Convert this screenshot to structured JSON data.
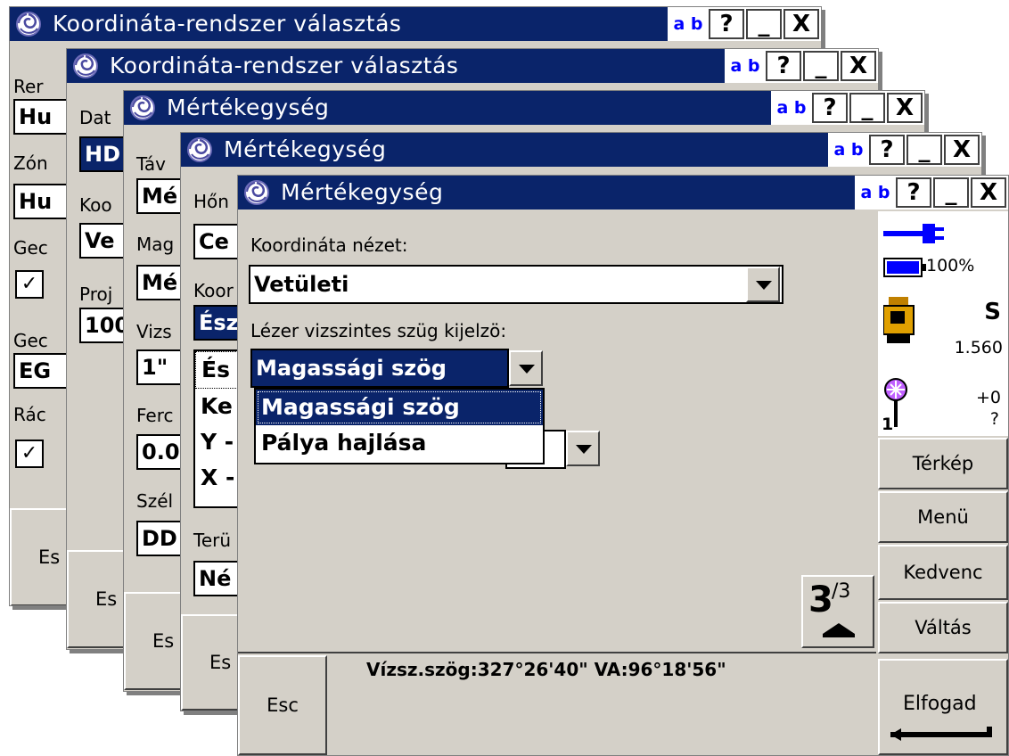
{
  "titlebar": {
    "ab_label": "a b",
    "help_label": "?",
    "minimize_label": "_",
    "close_label": "X"
  },
  "windows": {
    "w1": {
      "title": "Koordináta-rendszer választás",
      "labels": [
        "Rer",
        "Zón",
        "Gec",
        "Gec",
        "Rác"
      ],
      "fields": [
        "Hu",
        "Hu",
        "EG"
      ],
      "esc": "Es"
    },
    "w2": {
      "title": "Koordináta-rendszer választás",
      "labels": [
        "Dat",
        "Koo",
        "Proj"
      ],
      "fields": [
        "HD",
        "Ve",
        "100"
      ],
      "esc": "Es"
    },
    "w3": {
      "title": "Mértékegység",
      "labels": [
        "Táv",
        "Mag",
        "Vizs",
        "Ferc",
        "Szél"
      ],
      "fields": [
        "Mé",
        "Mé",
        "1\"",
        "0.0",
        "DD"
      ],
      "esc": "Es"
    },
    "w4": {
      "title": "Mértékegység",
      "labels": [
        "Hőn",
        "Koor",
        "Terü"
      ],
      "fields": [
        "Ce",
        "Ész",
        "Né"
      ],
      "list": [
        "És",
        "Ke",
        "Y -",
        "X -"
      ],
      "esc": "Es"
    },
    "w5": {
      "title": "Mértékegység",
      "coord_view_label": "Koordináta nézet:",
      "coord_view_value": "Vetületi",
      "laser_label": "Lézer vizszintes szüg kijelzö:",
      "laser_value": "Magassági szög",
      "dropdown_options": [
        "Magassági szög",
        "Pálya hajlása"
      ],
      "page_num": "3",
      "page_total": "/3",
      "battery_percent": "100%",
      "instrument_letter": "S",
      "instrument_height": "1.560",
      "prism_offset": "+0",
      "prism_number": "1",
      "prism_unknown": "?",
      "side_buttons": [
        "Térkép",
        "Menü",
        "Kedvenc",
        "Váltás"
      ],
      "status_text": "Vízsz.szög:327°26'40\"  VA:96°18'56\"",
      "esc_label": "Esc",
      "accept_label": "Elfogad"
    }
  },
  "colors": {
    "title_bg": "#0a246a",
    "window_bg": "#d4d0c8",
    "accent_blue": "#0000ff"
  }
}
